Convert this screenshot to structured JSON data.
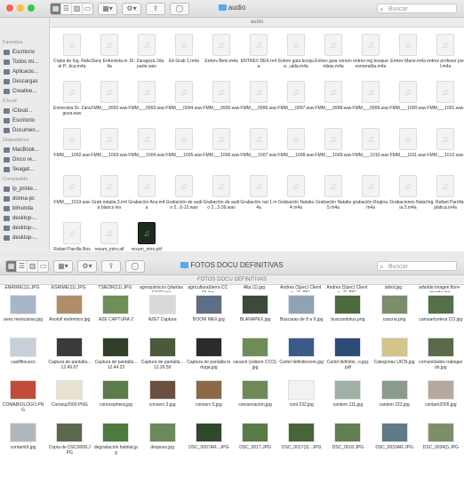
{
  "window1": {
    "title": "audio",
    "path": "audio",
    "search_placeholder": "Buscar",
    "sidebar": [
      {
        "type": "head",
        "label": "Favoritos"
      },
      {
        "type": "item",
        "label": "Escritorio",
        "icon": "desktop-icon"
      },
      {
        "type": "item",
        "label": "Todos mi...",
        "icon": "all-files-icon"
      },
      {
        "type": "item",
        "label": "Aplicacio...",
        "icon": "applications-icon"
      },
      {
        "type": "item",
        "label": "Descargas",
        "icon": "downloads-icon"
      },
      {
        "type": "item",
        "label": "Creative...",
        "icon": "folder-icon"
      },
      {
        "type": "head",
        "label": "iCloud"
      },
      {
        "type": "item",
        "label": "iCloud...",
        "icon": "cloud-icon"
      },
      {
        "type": "item",
        "label": "Escritorio",
        "icon": "desktop-icon"
      },
      {
        "type": "item",
        "label": "Documen...",
        "icon": "documents-icon"
      },
      {
        "type": "head",
        "label": "Dispositivos"
      },
      {
        "type": "item",
        "label": "MacBook...",
        "icon": "laptop-icon"
      },
      {
        "type": "item",
        "label": "Disco re...",
        "icon": "disk-icon"
      },
      {
        "type": "item",
        "label": "Seagat...",
        "icon": "drive-icon"
      },
      {
        "type": "head",
        "label": "Compartido"
      },
      {
        "type": "item",
        "label": "lp_printe...",
        "icon": "server-icon"
      },
      {
        "type": "item",
        "label": "donna-pc",
        "icon": "server-icon"
      },
      {
        "type": "item",
        "label": "blmunda",
        "icon": "server-icon"
      },
      {
        "type": "item",
        "label": "desktop-...",
        "icon": "server-icon"
      },
      {
        "type": "item",
        "label": "desktop-...",
        "icon": "server-icon"
      },
      {
        "type": "item",
        "label": "desktop-...",
        "icon": "server-icon"
      }
    ],
    "files": [
      "Copia de Ing. Rafael P...tica.m4a",
      "Dany Entrevista.m4a",
      "Dr. Zaragoza 2da parte.wav",
      "Ek Grab 1.m4a",
      "Entrev Beto.m4a",
      "ENTREV DEK.m4a",
      "Entrev guia bosque...alda.m4a",
      "Entrev guia cerezombas.m4a",
      "entrev ing bosque esmeralda.m4a",
      "Entrev Mario.m4a",
      "entrev profesor joel.m4a",
      "Entrevista Dr. Zaragoza.wav",
      "FMM___0992.wav",
      "FMM___0993.wav",
      "FMM___0994.wav",
      "FMM___0995.wav",
      "FMM___0996.wav",
      "FMM___0997.wav",
      "FMM___0998.wav",
      "FMM___0999.wav",
      "FMM___1000.wav",
      "FMM___1001.wav",
      "FMM___1002.wav",
      "FMM___1003.wav",
      "FMM___1004.wav",
      "FMM___1005.wav",
      "FMM___1006.wav",
      "FMM___1007.wav",
      "FMM___1008.wav",
      "FMM___1009.wav",
      "FMM___1010.wav",
      "FMM___1011.wav",
      "FMM___1012.wav",
      "FMM___1013.wav",
      "Grab natalia 3.m4a blanco les",
      "Grabación Ana.m4a",
      "Grabación de audio 2...0-12.wav",
      "Grabación de audio 2...3-39.wav",
      "Grabación nat 1.m4a",
      "Grabación Natalia 4.m4a",
      "Grabación Natalia 5.m4a",
      "grabación Regina.m4a",
      "Grabaciones Natalia 2.m4a",
      "Ing. Rafael Parrilla platica.m4a",
      "Rafael Parrilla Bosque_Uruapan",
      "resum_intro.aif",
      "resum_intro.pkf"
    ]
  },
  "window2": {
    "title": "FOTOS DOCU DEFINITIVAS",
    "path": "FOTOS DOCU DEFINITIVAS",
    "search_placeholder": "Buscar",
    "top_labels": [
      "ENRIME(11).JPG",
      "ESRIME(11).JPG",
      "TSIEDR(11).JPG",
      "agroquimicos (plantas CCO).jpg",
      "agricultura(tierra CCO).jpg",
      "Alta (1).jpg",
      "Andres (Spec) Cliente...D.JPG",
      "Andres (Spec) Cliente...D.JPG",
      "árbol.jpg",
      "arbolde imagen flore-google.jpg"
    ],
    "photos": [
      {
        "name": "aves mexicanas.jpg",
        "color": "#a7b6c9"
      },
      {
        "name": "Axolotl endemico.jpg",
        "color": "#b08e6a"
      },
      {
        "name": "AZE CAPTURA 2",
        "color": "#6f8f5a"
      },
      {
        "name": "AZE7 Captura",
        "color": "#d9d9d9"
      },
      {
        "name": "BOOM MÉX.jpg",
        "color": "#5c6f84"
      },
      {
        "name": "BLANAPEX.jpg",
        "color": "#3d4a3a"
      },
      {
        "name": "Buscaras de 8 a 9.jpg",
        "color": "#8fa3b5"
      },
      {
        "name": "buscandotus.png",
        "color": "#4b6b3d"
      },
      {
        "name": "cascria.png",
        "color": "#7b8d6b"
      },
      {
        "name": "camuartyotera CO.jpg",
        "color": "#55704a"
      },
      {
        "name": "castfiltousco",
        "color": "#c7cfd8"
      },
      {
        "name": "Captura de pantalla...12.49.07",
        "color": "#3a3a3a"
      },
      {
        "name": "Captura de pantalla...12.44.23",
        "color": "#2f3f2a"
      },
      {
        "name": "Captura de pantalla...12.26.59",
        "color": "#4a5a3b"
      },
      {
        "name": "Captura de pantalla tortuga.jpg",
        "color": "#2b2b2b"
      },
      {
        "name": "caracol (sobere CCO).jpg",
        "color": "#6e8c58"
      },
      {
        "name": "Cartel definitivoore.jpg",
        "color": "#3c5a88"
      },
      {
        "name": "Cartel definitiv...o.jpg.pdf",
        "color": "#2e4b78"
      },
      {
        "name": "Categorias UICN.jpg",
        "color": "#d3c58a"
      },
      {
        "name": "comunidades trabajando.jpg",
        "color": "#5a6a4a"
      },
      {
        "name": "COMABIOLOGO.PNG",
        "color": "#c44a3a"
      },
      {
        "name": "Conanp2000.PNG",
        "color": "#e7e2d2"
      },
      {
        "name": "conocephera.jpg",
        "color": "#5d7a4a"
      },
      {
        "name": "conserv 3.jpg",
        "color": "#6b5040"
      },
      {
        "name": "conserv 5.jpg",
        "color": "#8a6a48"
      },
      {
        "name": "conservación.jpg",
        "color": "#6f8859"
      },
      {
        "name": "cont 232.jpg",
        "color": "#f2f2f2"
      },
      {
        "name": "cantem 111.jpg",
        "color": "#9fb0a5"
      },
      {
        "name": "cantem 222.jpg",
        "color": "#8a9c8c"
      },
      {
        "name": "contam2005.jpg",
        "color": "#b4a9a0"
      },
      {
        "name": "contamIII.jpg",
        "color": "#b0b8bf"
      },
      {
        "name": "Copia de DSC0008.JPG",
        "color": "#5c6a4b"
      },
      {
        "name": "degradación habitat.jpg",
        "color": "#4d7a3d"
      },
      {
        "name": "desposs.jpg",
        "color": "#6a8a5a"
      },
      {
        "name": "DSC_0007AR...JPG",
        "color": "#2f4a2a"
      },
      {
        "name": "DSC_0017.JPG",
        "color": "#587b48"
      },
      {
        "name": "DSC_0017(3)...JPG",
        "color": "#48653a"
      },
      {
        "name": "DSC_0018.JPG",
        "color": "#627f52"
      },
      {
        "name": "DSC_0033AR.JPG",
        "color": "#5f7a8a"
      },
      {
        "name": "DSC_0034(I).JPG",
        "color": "#7d8f6a"
      }
    ]
  }
}
